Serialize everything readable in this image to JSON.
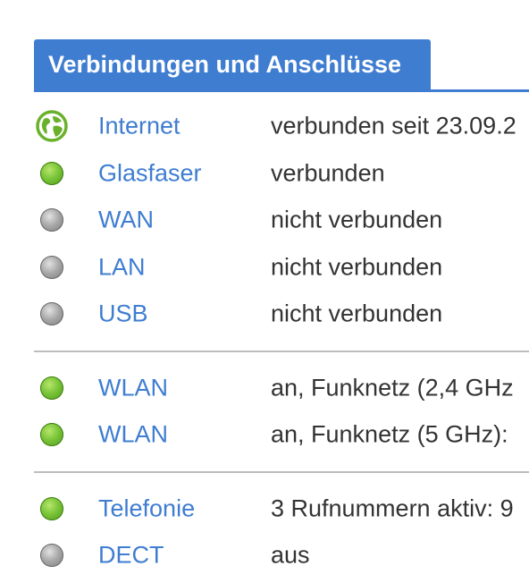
{
  "header": {
    "title": "Verbindungen und Anschlüsse"
  },
  "colors": {
    "accent": "#3f7dd1",
    "connected": "#79c438",
    "disconnected": "#a9a9a9"
  },
  "groups": [
    {
      "rows": [
        {
          "icon": "globe-icon",
          "state": "connected",
          "name": "Internet",
          "info": "verbunden seit 23.09.2"
        },
        {
          "icon": "status-dot-icon",
          "state": "connected",
          "name": "Glasfaser",
          "info": "verbunden"
        },
        {
          "icon": "status-dot-icon",
          "state": "disconnected",
          "name": "WAN",
          "info": "nicht verbunden"
        },
        {
          "icon": "status-dot-icon",
          "state": "disconnected",
          "name": "LAN",
          "info": "nicht verbunden"
        },
        {
          "icon": "status-dot-icon",
          "state": "disconnected",
          "name": "USB",
          "info": "nicht verbunden"
        }
      ]
    },
    {
      "rows": [
        {
          "icon": "status-dot-icon",
          "state": "connected",
          "name": "WLAN",
          "info": "an, Funknetz (2,4 GHz"
        },
        {
          "icon": "status-dot-icon",
          "state": "connected",
          "name": "WLAN",
          "info": "an, Funknetz (5 GHz):"
        }
      ]
    },
    {
      "rows": [
        {
          "icon": "status-dot-icon",
          "state": "connected",
          "name": "Telefonie",
          "info": "3 Rufnummern aktiv: 9"
        },
        {
          "icon": "status-dot-icon",
          "state": "disconnected",
          "name": "DECT",
          "info": "aus"
        }
      ]
    }
  ]
}
